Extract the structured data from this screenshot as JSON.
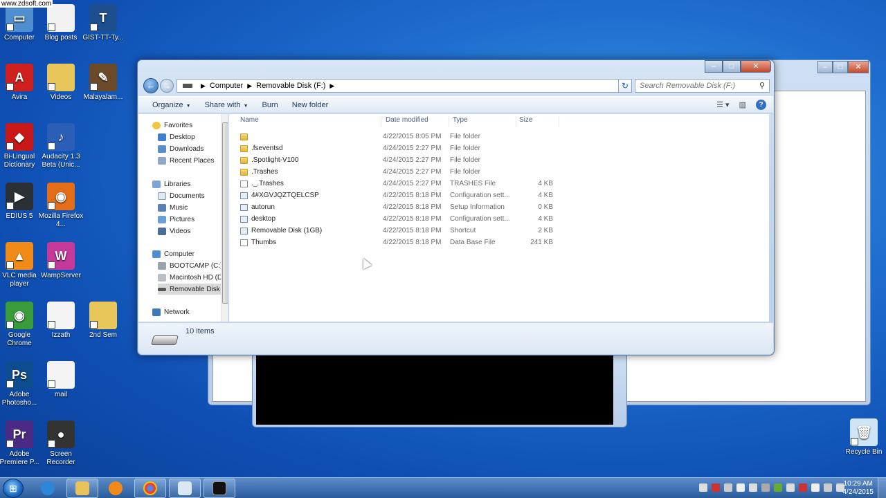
{
  "watermark": "www.zdsoft.com",
  "desktop_icons": [
    {
      "label": "Computer",
      "color": "#4f8fd0",
      "glyph": "▭"
    },
    {
      "label": "Blog posts",
      "color": "#f2f2f2",
      "glyph": ""
    },
    {
      "label": "GIST-TT-Ty...",
      "color": "#1d4f8f",
      "glyph": "T"
    },
    {
      "label": "Avira",
      "color": "#d01f1f",
      "glyph": "A"
    },
    {
      "label": "Videos",
      "color": "#e9c65a",
      "glyph": ""
    },
    {
      "label": "Malayalam...",
      "color": "#6b4a2a",
      "glyph": "✎"
    },
    {
      "label": "Bi-Lingual Dictionary",
      "color": "#c81818",
      "glyph": "◆"
    },
    {
      "label": "Audacity 1.3 Beta (Unic...",
      "color": "#2b5fb7",
      "glyph": "♪"
    },
    {
      "label": "EDIUS 5",
      "color": "#2a3036",
      "glyph": "▶"
    },
    {
      "label": "Mozilla Firefox 4...",
      "color": "#e46d18",
      "glyph": "◉"
    },
    {
      "label": "VLC media player",
      "color": "#f08a18",
      "glyph": "▲"
    },
    {
      "label": "WampServer",
      "color": "#c4399a",
      "glyph": "W"
    },
    {
      "label": "Google Chrome",
      "color": "#3a9b3a",
      "glyph": "◉"
    },
    {
      "label": "Izzath",
      "color": "#f4f4f4",
      "glyph": ""
    },
    {
      "label": "2nd Sem",
      "color": "#e9c65a",
      "glyph": ""
    },
    {
      "label": "Adobe Photosho...",
      "color": "#0d4c8f",
      "glyph": "Ps"
    },
    {
      "label": "mail",
      "color": "#f4f4f4",
      "glyph": ""
    },
    {
      "label": "Adobe Premiere P...",
      "color": "#4b2a86",
      "glyph": "Pr"
    },
    {
      "label": "Screen Recorder",
      "color": "#333333",
      "glyph": "●"
    },
    {
      "label": "Recycle Bin",
      "color": "#cfe4f5",
      "glyph": "🗑"
    }
  ],
  "explorer": {
    "address": {
      "segments": [
        "Computer",
        "Removable Disk (F:)"
      ]
    },
    "search_placeholder": "Search Removable Disk (F:)",
    "toolbar": {
      "organize": "Organize",
      "share_with": "Share with",
      "burn": "Burn",
      "new_folder": "New folder"
    },
    "nav": {
      "favorites": "Favorites",
      "desktop": "Desktop",
      "downloads": "Downloads",
      "recent_places": "Recent Places",
      "libraries": "Libraries",
      "documents": "Documents",
      "music": "Music",
      "pictures": "Pictures",
      "videos": "Videos",
      "computer": "Computer",
      "bootcamp": "BOOTCAMP (C:)",
      "macintosh": "Macintosh HD (D",
      "removable": "Removable Disk (",
      "network": "Network"
    },
    "columns": {
      "name": "Name",
      "date": "Date modified",
      "type": "Type",
      "size": "Size"
    },
    "files": [
      {
        "name": "",
        "date": "4/22/2015 8:05 PM",
        "type": "File folder",
        "size": "",
        "kind": "folder"
      },
      {
        "name": ".fseventsd",
        "date": "4/24/2015 2:27 PM",
        "type": "File folder",
        "size": "",
        "kind": "folder"
      },
      {
        "name": ".Spotlight-V100",
        "date": "4/24/2015 2:27 PM",
        "type": "File folder",
        "size": "",
        "kind": "folder"
      },
      {
        "name": ".Trashes",
        "date": "4/24/2015 2:27 PM",
        "type": "File folder",
        "size": "",
        "kind": "folder"
      },
      {
        "name": "._.Trashes",
        "date": "4/24/2015 2:27 PM",
        "type": "TRASHES File",
        "size": "4 KB",
        "kind": "doc"
      },
      {
        "name": "4#XGVJQZTQELCSP",
        "date": "4/22/2015 8:18 PM",
        "type": "Configuration sett...",
        "size": "4 KB",
        "kind": "cfg"
      },
      {
        "name": "autorun",
        "date": "4/22/2015 8:18 PM",
        "type": "Setup Information",
        "size": "0 KB",
        "kind": "cfg"
      },
      {
        "name": "desktop",
        "date": "4/22/2015 8:18 PM",
        "type": "Configuration sett...",
        "size": "4 KB",
        "kind": "cfg"
      },
      {
        "name": "Removable Disk (1GB)",
        "date": "4/22/2015 8:18 PM",
        "type": "Shortcut",
        "size": "2 KB",
        "kind": "cfg"
      },
      {
        "name": "Thumbs",
        "date": "4/22/2015 8:18 PM",
        "type": "Data Base File",
        "size": "241 KB",
        "kind": "doc"
      }
    ],
    "status": "10 items"
  },
  "clock": {
    "time": "10:29 AM",
    "date": "4/24/2015"
  }
}
